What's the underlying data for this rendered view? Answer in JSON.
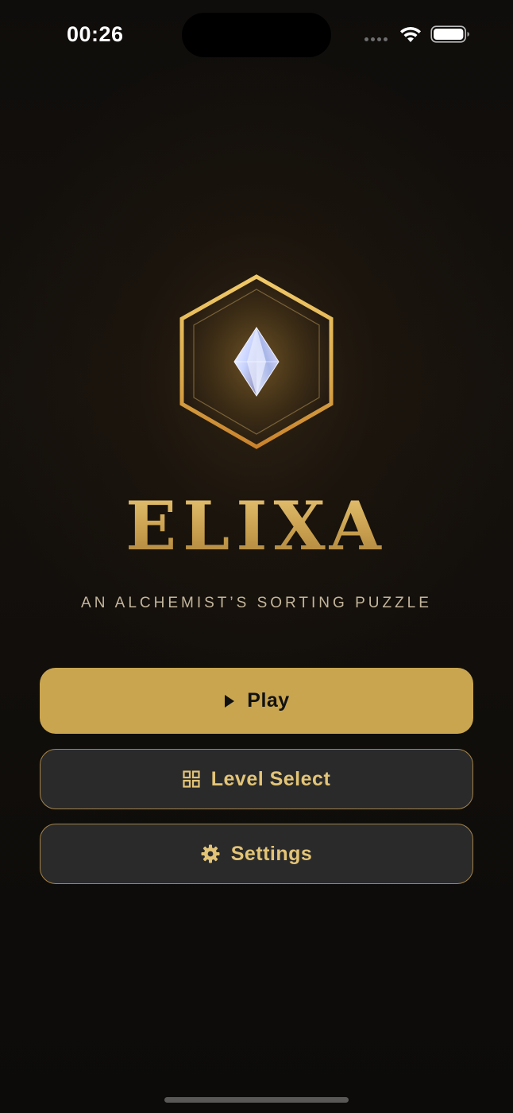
{
  "status_bar": {
    "time": "00:26",
    "icons": [
      "signal-dots-icon",
      "wifi-icon",
      "battery-icon"
    ]
  },
  "hero": {
    "emblem_icon": "crystal-hexagon-icon",
    "title": "ELIXA",
    "subtitle": "AN ALCHEMIST’S SORTING PUZZLE"
  },
  "menu": {
    "play_label": "Play",
    "play_icon": "play-icon",
    "level_select_label": "Level Select",
    "level_select_icon": "grid-icon",
    "settings_label": "Settings",
    "settings_icon": "gear-icon"
  },
  "colors": {
    "accent_gold": "#c9a54f",
    "button_dark": "#2a2a2b",
    "button_border": "#a3844a",
    "background": "#0c0a08"
  }
}
